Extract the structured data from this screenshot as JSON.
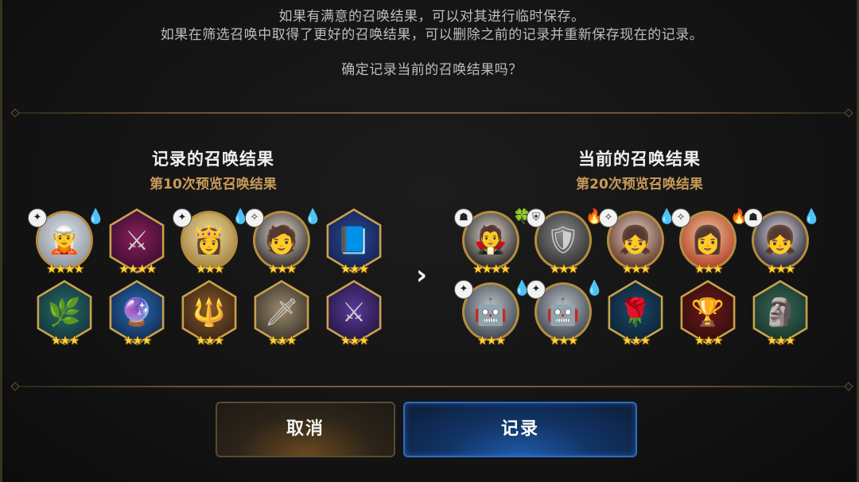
{
  "dialog": {
    "line1": "如果有满意的召唤结果，可以对其进行临时保存。",
    "line2": "如果在筛选召唤中取得了更好的召唤结果，可以删除之前的记录并重新保存现在的记录。",
    "question": "确定记录当前的召唤结果吗？"
  },
  "recorded": {
    "title": "记录的召唤结果",
    "subtitle": "第10次预览召唤结果",
    "items": [
      {
        "kind": "hero",
        "element": "ice",
        "role": "soul-weaver",
        "stars": "★★★★",
        "figure": "silver-haired-girl"
      },
      {
        "kind": "artifact",
        "stars": "★★★★",
        "figure": "crimson-weapon"
      },
      {
        "kind": "hero",
        "element": "ice",
        "role": "soul-weaver",
        "stars": "★★★",
        "figure": "blonde-girl"
      },
      {
        "kind": "hero",
        "element": "ice",
        "role": "mage",
        "stars": "★★★",
        "figure": "dark-haired-boy"
      },
      {
        "kind": "artifact",
        "stars": "★★★",
        "figure": "blue-book"
      },
      {
        "kind": "artifact",
        "stars": "★★★",
        "figure": "green-wreath"
      },
      {
        "kind": "artifact",
        "stars": "★★★",
        "figure": "blue-orb-staff"
      },
      {
        "kind": "artifact",
        "stars": "★★★",
        "figure": "golden-trident"
      },
      {
        "kind": "artifact",
        "stars": "★★★",
        "figure": "golden-sword"
      },
      {
        "kind": "artifact",
        "stars": "★★★",
        "figure": "purple-blade"
      }
    ]
  },
  "current": {
    "title": "当前的召唤结果",
    "subtitle": "第20次预览召唤结果",
    "items": [
      {
        "kind": "hero",
        "element": "earth",
        "role": "thief",
        "stars": "★★★★",
        "figure": "black-haired-man"
      },
      {
        "kind": "hero",
        "element": "fire",
        "role": "knight",
        "stars": "★★★",
        "figure": "armored-knight"
      },
      {
        "kind": "hero",
        "element": "ice",
        "role": "mage",
        "stars": "★★★",
        "figure": "brown-haired-girl"
      },
      {
        "kind": "hero",
        "element": "fire",
        "role": "mage",
        "stars": "★★★",
        "figure": "red-haired-girl"
      },
      {
        "kind": "hero",
        "element": "ice",
        "role": "thief",
        "stars": "★★★",
        "figure": "dark-haired-girl"
      },
      {
        "kind": "hero",
        "element": "ice",
        "role": "soul-weaver",
        "stars": "★★★",
        "figure": "robot-knight"
      },
      {
        "kind": "hero",
        "element": "ice",
        "role": "soul-weaver",
        "stars": "★★★",
        "figure": "robot-knight"
      },
      {
        "kind": "artifact",
        "stars": "★★★",
        "figure": "rose"
      },
      {
        "kind": "artifact",
        "stars": "★★★",
        "figure": "golden-chalice"
      },
      {
        "kind": "artifact",
        "stars": "★★★",
        "figure": "wooden-totem"
      }
    ]
  },
  "buttons": {
    "cancel": "取消",
    "record": "记录"
  },
  "colors": {
    "gold_border": "#c9a24a",
    "subtitle_gold": "#c89a5a",
    "record_blue": "#1e5aa8",
    "cancel_brown": "#6a4a20"
  },
  "icons": {
    "next": "chevron-right-icon"
  }
}
